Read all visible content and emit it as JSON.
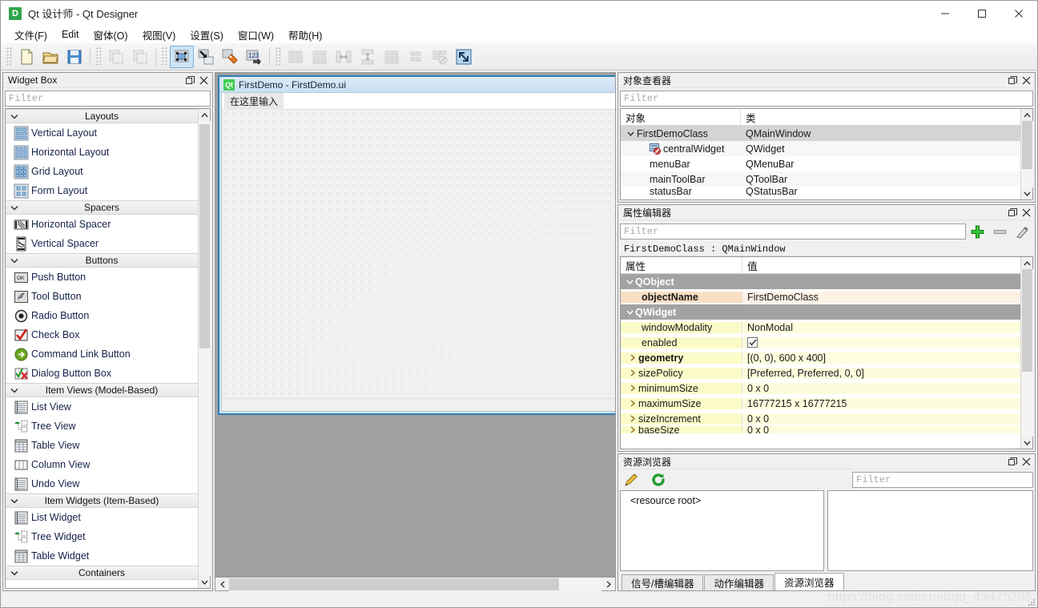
{
  "window": {
    "title": "Qt 设计师 - Qt Designer",
    "app_icon": "D",
    "minimize": "minimize-icon",
    "maximize": "maximize-icon",
    "close": "close-icon"
  },
  "menubar": {
    "items": [
      {
        "label": "文件(F)",
        "mnemonic": "F"
      },
      {
        "label": "Edit",
        "mnemonic": "E"
      },
      {
        "label": "窗体(O)",
        "mnemonic": "O"
      },
      {
        "label": "视图(V)",
        "mnemonic": "V"
      },
      {
        "label": "设置(S)",
        "mnemonic": "S"
      },
      {
        "label": "窗口(W)",
        "mnemonic": "W"
      },
      {
        "label": "帮助(H)",
        "mnemonic": "H"
      }
    ]
  },
  "toolbar": {
    "groups": [
      {
        "buttons": [
          {
            "name": "new-form-icon",
            "enabled": true
          },
          {
            "name": "open-form-icon",
            "enabled": true
          },
          {
            "name": "save-form-icon",
            "enabled": true
          }
        ]
      },
      {
        "buttons": [
          {
            "name": "undo-icon",
            "enabled": false
          },
          {
            "name": "redo-icon",
            "enabled": false
          }
        ]
      },
      {
        "buttons": [
          {
            "name": "edit-widgets-icon",
            "enabled": true,
            "active": true
          },
          {
            "name": "edit-signals-slots-icon",
            "enabled": true
          },
          {
            "name": "edit-buddies-icon",
            "enabled": true
          },
          {
            "name": "edit-tab-order-icon",
            "enabled": true
          }
        ]
      },
      {
        "buttons": [
          {
            "name": "layout-horizontally-icon",
            "enabled": false
          },
          {
            "name": "layout-vertically-icon",
            "enabled": false
          },
          {
            "name": "layout-in-splitter-horizontal-icon",
            "enabled": false
          },
          {
            "name": "layout-in-splitter-vertical-icon",
            "enabled": false
          },
          {
            "name": "layout-in-grid-icon",
            "enabled": false
          },
          {
            "name": "layout-in-form-icon",
            "enabled": false
          },
          {
            "name": "break-layout-icon",
            "enabled": false
          },
          {
            "name": "adjust-size-icon",
            "enabled": true
          }
        ]
      }
    ]
  },
  "widget_box": {
    "title": "Widget Box",
    "filter_placeholder": "Filter",
    "categories": [
      {
        "label": "Layouts",
        "expanded": true,
        "items": [
          {
            "label": "Vertical Layout",
            "icon": "vertical-layout-icon"
          },
          {
            "label": "Horizontal Layout",
            "icon": "horizontal-layout-icon"
          },
          {
            "label": "Grid Layout",
            "icon": "grid-layout-icon"
          },
          {
            "label": "Form Layout",
            "icon": "form-layout-icon"
          }
        ]
      },
      {
        "label": "Spacers",
        "expanded": true,
        "items": [
          {
            "label": "Horizontal Spacer",
            "icon": "horizontal-spacer-icon"
          },
          {
            "label": "Vertical Spacer",
            "icon": "vertical-spacer-icon"
          }
        ]
      },
      {
        "label": "Buttons",
        "expanded": true,
        "items": [
          {
            "label": "Push Button",
            "icon": "push-button-icon"
          },
          {
            "label": "Tool Button",
            "icon": "tool-button-icon"
          },
          {
            "label": "Radio Button",
            "icon": "radio-button-icon"
          },
          {
            "label": "Check Box",
            "icon": "check-box-icon"
          },
          {
            "label": "Command Link Button",
            "icon": "command-link-button-icon"
          },
          {
            "label": "Dialog Button Box",
            "icon": "dialog-button-box-icon"
          }
        ]
      },
      {
        "label": "Item Views (Model-Based)",
        "expanded": true,
        "items": [
          {
            "label": "List View",
            "icon": "list-view-icon"
          },
          {
            "label": "Tree View",
            "icon": "tree-view-icon"
          },
          {
            "label": "Table View",
            "icon": "table-view-icon"
          },
          {
            "label": "Column View",
            "icon": "column-view-icon"
          },
          {
            "label": "Undo View",
            "icon": "undo-view-icon"
          }
        ]
      },
      {
        "label": "Item Widgets (Item-Based)",
        "expanded": true,
        "items": [
          {
            "label": "List Widget",
            "icon": "list-widget-icon"
          },
          {
            "label": "Tree Widget",
            "icon": "tree-widget-icon"
          },
          {
            "label": "Table Widget",
            "icon": "table-widget-icon"
          }
        ]
      },
      {
        "label": "Containers",
        "expanded": true,
        "items": []
      }
    ]
  },
  "form_window": {
    "title": "FirstDemo - FirstDemo.ui",
    "logo_text": "Qt",
    "menubar_placeholder": "在这里输入"
  },
  "object_inspector": {
    "title": "对象查看器",
    "filter_placeholder": "Filter",
    "columns": [
      "对象",
      "类"
    ],
    "rows": [
      {
        "name": "FirstDemoClass",
        "class": "QMainWindow",
        "depth": 0,
        "expander": true,
        "selected": true,
        "icon": ""
      },
      {
        "name": "centralWidget",
        "class": "QWidget",
        "depth": 1,
        "expander": false,
        "selected": false,
        "icon": "central-widget-icon"
      },
      {
        "name": "menuBar",
        "class": "QMenuBar",
        "depth": 1,
        "expander": false,
        "selected": false,
        "icon": ""
      },
      {
        "name": "mainToolBar",
        "class": "QToolBar",
        "depth": 1,
        "expander": false,
        "selected": false,
        "icon": ""
      },
      {
        "name": "statusBar",
        "class": "QStatusBar",
        "depth": 1,
        "expander": false,
        "selected": false,
        "icon": ""
      }
    ]
  },
  "property_editor": {
    "title": "属性编辑器",
    "filter_placeholder": "Filter",
    "add_button": "add-icon",
    "remove_button": "remove-icon",
    "configure_button": "configure-icon",
    "class_line": "FirstDemoClass : QMainWindow",
    "columns": [
      "属性",
      "值"
    ],
    "rows": [
      {
        "kind": "group",
        "name": "QObject",
        "value": ""
      },
      {
        "kind": "prop",
        "name": "objectName",
        "value": "FirstDemoClass",
        "bold": true,
        "tint": "peach",
        "expander": false
      },
      {
        "kind": "group",
        "name": "QWidget",
        "value": ""
      },
      {
        "kind": "prop",
        "name": "windowModality",
        "value": "NonModal",
        "bold": false,
        "tint": "yellow",
        "expander": false
      },
      {
        "kind": "prop",
        "name": "enabled",
        "value": "",
        "bold": false,
        "tint": "yellow",
        "expander": false,
        "checkbox": true,
        "checked": true
      },
      {
        "kind": "prop",
        "name": "geometry",
        "value": "[(0, 0), 600 x 400]",
        "bold": true,
        "tint": "yellow",
        "expander": true
      },
      {
        "kind": "prop",
        "name": "sizePolicy",
        "value": "[Preferred, Preferred, 0, 0]",
        "bold": false,
        "tint": "yellow",
        "expander": true
      },
      {
        "kind": "prop",
        "name": "minimumSize",
        "value": "0 x 0",
        "bold": false,
        "tint": "yellow",
        "expander": true
      },
      {
        "kind": "prop",
        "name": "maximumSize",
        "value": "16777215 x 16777215",
        "bold": false,
        "tint": "yellow",
        "expander": true
      },
      {
        "kind": "prop",
        "name": "sizeIncrement",
        "value": "0 x 0",
        "bold": false,
        "tint": "yellow",
        "expander": true
      },
      {
        "kind": "prop",
        "name": "baseSize",
        "value": "0 x 0",
        "bold": false,
        "tint": "yellow",
        "expander": true
      }
    ]
  },
  "resource_browser": {
    "title": "资源浏览器",
    "edit_button": "pencil-icon",
    "reload_button": "reload-icon",
    "filter_placeholder": "Filter",
    "tree_root": "<resource root>",
    "tabs": [
      {
        "label": "信号/槽编辑器",
        "selected": false
      },
      {
        "label": "动作编辑器",
        "selected": false
      },
      {
        "label": "资源浏览器",
        "selected": true
      }
    ]
  },
  "watermark": "https://blog.csdn.net/qq_43475285",
  "colors": {
    "accent_blue": "#2f7fb5",
    "toolbar_active": "#cce4f7",
    "group_header": "#a3a3a3",
    "prop_peach": "#f9dfc3",
    "prop_yellow": "#fbfbc8",
    "mdi_background": "#a0a0a0",
    "qt_green": "#41cd52"
  }
}
